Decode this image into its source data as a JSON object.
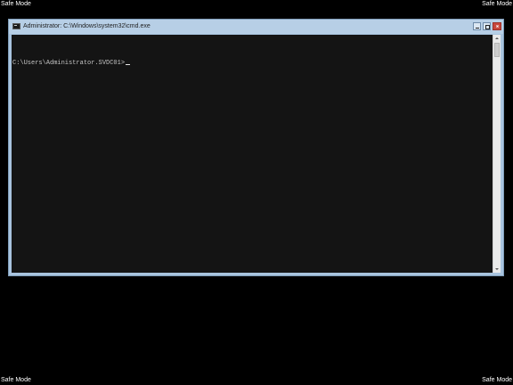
{
  "desktop": {
    "corner_labels": {
      "top_left": "Safe Mode",
      "top_right": "Safe Mode",
      "bottom_left": "Safe Mode",
      "bottom_right": "Safe Mode"
    }
  },
  "window": {
    "title": "Administrator: C:\\Windows\\system32\\cmd.exe",
    "icon": "cmd-icon",
    "controls": [
      "minimize-icon",
      "maximize-icon",
      "close-icon"
    ]
  },
  "console": {
    "prompt": "C:\\Users\\Administrator.SVDC01>",
    "input": "",
    "background": "#141414",
    "foreground": "#c4c4c4"
  },
  "colors": {
    "desktop_background": "#000000",
    "titlebar": "#b7cfe6",
    "close_button": "#c7473d"
  }
}
